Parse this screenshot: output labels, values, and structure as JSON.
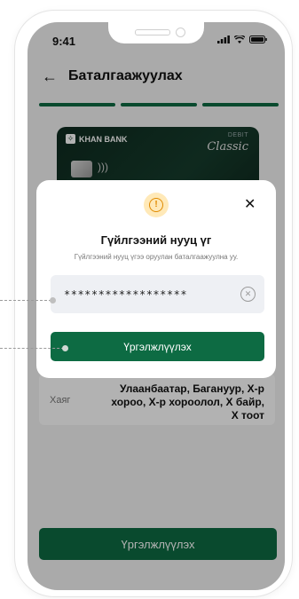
{
  "status": {
    "time": "9:41"
  },
  "header": {
    "title": "Баталгаажуулах"
  },
  "card": {
    "bank_name": "KHAN BANK",
    "type": "DEBIT",
    "tier": "Classic"
  },
  "address": {
    "label": "Хаяг",
    "value": "Улаанбаатар, Багануур, Х-р хороо, Х-р хороолол, Х байр, Х тоот"
  },
  "bottom_button": {
    "label": "Үргэлжлүүлэх"
  },
  "modal": {
    "title": "Гүйлгээний нууц үг",
    "subtitle": "Гүйлгээний нууц үгээ оруулан баталгаажуулна уу.",
    "password_value": "******************",
    "continue_label": "Үргэлжлүүлэх"
  },
  "colors": {
    "primary": "#0d6b43",
    "warning": "#e08a00"
  }
}
